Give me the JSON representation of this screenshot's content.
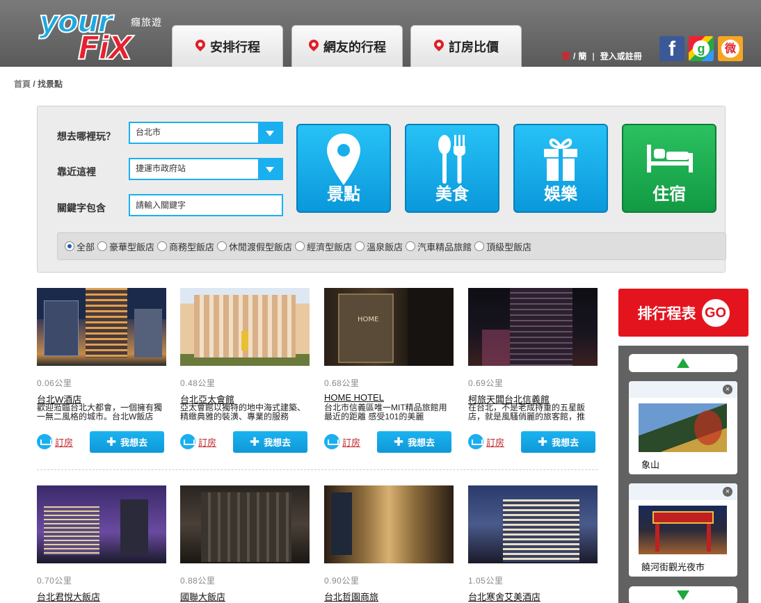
{
  "brand": {
    "logo_top": "your",
    "logo_bottom": "FiX",
    "tagline": "癮旅遊"
  },
  "nav": {
    "tabs": [
      {
        "label": "安排行程"
      },
      {
        "label": "網友的行程"
      },
      {
        "label": "訂房比價"
      }
    ],
    "lang_traditional": "繁",
    "lang_slash": "/",
    "lang_simplified": "簡",
    "login": "登入或註冊"
  },
  "social": {
    "facebook": "f",
    "google": "g",
    "weibo": "微"
  },
  "breadcrumb": {
    "home": "首頁",
    "sep": " / ",
    "current": "找景點"
  },
  "search": {
    "where_label": "想去哪裡玩？",
    "where_value": "台北市",
    "near_label": "靠近這裡",
    "near_value": "捷運市政府站",
    "keyword_label": "關鍵字包含",
    "keyword_placeholder": "請輸入關鍵字"
  },
  "categories": [
    {
      "label": "景點",
      "icon": "location-pin-icon"
    },
    {
      "label": "美食",
      "icon": "fork-spoon-icon"
    },
    {
      "label": "娛樂",
      "icon": "gift-icon"
    },
    {
      "label": "住宿",
      "icon": "bed-icon"
    }
  ],
  "filters": [
    {
      "label": "全部",
      "checked": true
    },
    {
      "label": "豪華型飯店"
    },
    {
      "label": "商務型飯店"
    },
    {
      "label": "休閒渡假型飯店"
    },
    {
      "label": "經濟型飯店"
    },
    {
      "label": "溫泉飯店"
    },
    {
      "label": "汽車精品旅館"
    },
    {
      "label": "頂級型飯店"
    }
  ],
  "hotels": [
    {
      "distance": "0.06公里",
      "name": "台北W酒店",
      "desc": "歡迎蒞臨台北大都會，一個擁有獨一無二風格的城市。台北W飯店",
      "book": "訂房",
      "want": "我想去"
    },
    {
      "distance": "0.48公里",
      "name": "台北亞太會館",
      "desc": "亞太會館以獨特的地中海式建築、精緻典雅的裝潢、專業的服務",
      "book": "訂房",
      "want": "我想去"
    },
    {
      "distance": "0.68公里",
      "name": "HOME HOTEL",
      "desc": "台北市信義區唯一MIT精品旅館用最近的距離 感受101的美麗",
      "book": "訂房",
      "want": "我想去"
    },
    {
      "distance": "0.69公里",
      "name": "柯旅天闆台北信義館",
      "desc": "在台北，不是老成持重的五星飯店，就是風騷俏麗的旅客館，推",
      "book": "訂房",
      "want": "我想去"
    },
    {
      "distance": "0.70公里",
      "name": "台北君悅大飯店"
    },
    {
      "distance": "0.88公里",
      "name": "國聯大飯店"
    },
    {
      "distance": "0.90公里",
      "name": "台北哲園商旅"
    },
    {
      "distance": "1.05公里",
      "name": "台北寒舍艾美酒店"
    }
  ],
  "sidebar": {
    "schedule_label": "排行程表",
    "go": "GO",
    "close": "×",
    "spots": [
      {
        "name": "象山"
      },
      {
        "name": "饒河街觀光夜市"
      }
    ]
  },
  "colors": {
    "accent_blue": "#1ab0f0",
    "accent_green": "#1fa83c",
    "brand_red": "#e4141e"
  }
}
